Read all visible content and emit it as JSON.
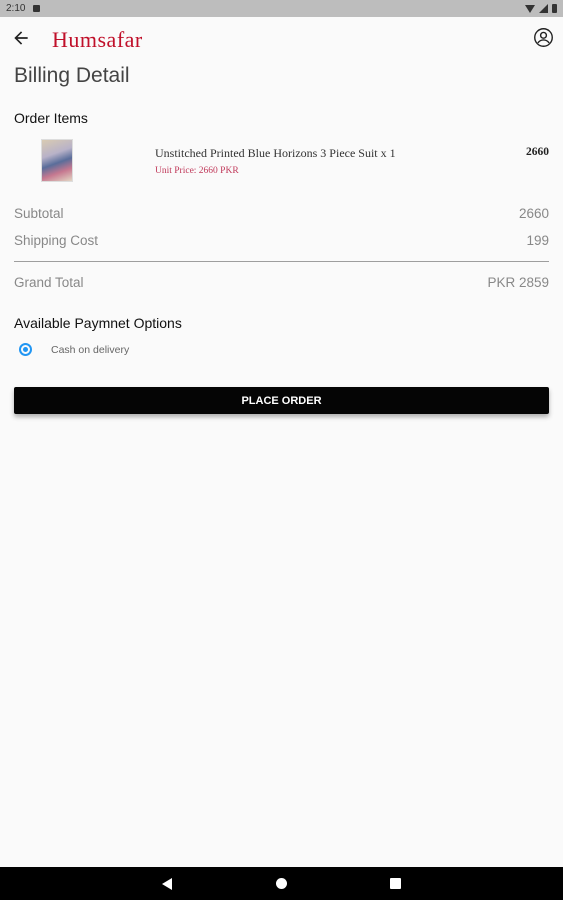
{
  "status_bar": {
    "time": "2:10"
  },
  "app": {
    "logo_text": "Humsafar"
  },
  "page": {
    "title": "Billing Detail"
  },
  "order": {
    "section_title": "Order Items",
    "items": [
      {
        "name": "Unstitched Printed Blue Horizons 3 Piece Suit x  1",
        "unit_price": "Unit Price: 2660 PKR",
        "total": "2660"
      }
    ]
  },
  "summary": {
    "subtotal_label": "Subtotal",
    "subtotal_value": "2660",
    "shipping_label": "Shipping Cost",
    "shipping_value": "199",
    "grand_label": "Grand Total",
    "grand_value": "PKR 2859"
  },
  "payment": {
    "section_title": "Available Paymnet Options",
    "options": [
      {
        "label": "Cash on delivery",
        "selected": true
      }
    ]
  },
  "actions": {
    "place_order": "PLACE ORDER"
  },
  "colors": {
    "brand": "#c0102a",
    "radio_accent": "#2196f3",
    "button_bg": "#050505"
  }
}
